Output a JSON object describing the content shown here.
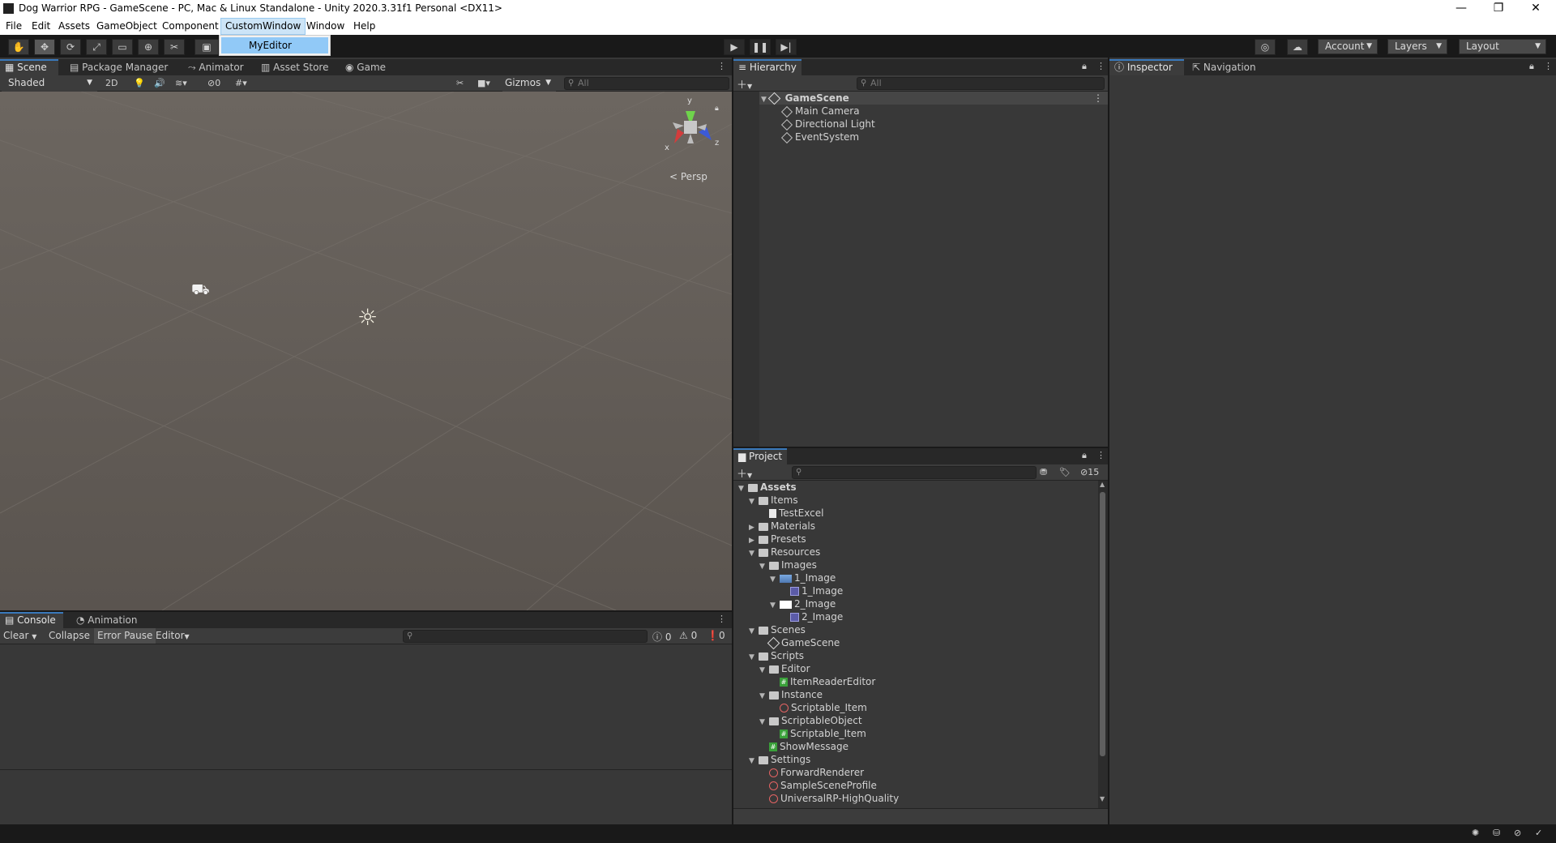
{
  "window": {
    "title": "Dog Warrior RPG - GameScene - PC, Mac & Linux Standalone - Unity 2020.3.31f1 Personal <DX11>",
    "minimize": "—",
    "maximize": "❐",
    "close": "✕"
  },
  "menu": {
    "items": [
      "File",
      "Edit",
      "Assets",
      "GameObject",
      "Component",
      "CustomWindow",
      "Window",
      "Help"
    ],
    "dropdown_item": "MyEditor"
  },
  "toolbar": {
    "account": "Account",
    "layers": "Layers",
    "layout": "Layout"
  },
  "scene_panel": {
    "tabs": [
      "Scene",
      "Package Manager",
      "Animator",
      "Asset Store",
      "Game"
    ],
    "shading": "Shaded",
    "mode_2d": "2D",
    "hidden_count": "0",
    "gizmos": "Gizmos",
    "search_placeholder": "All",
    "persp_label": "Persp",
    "axes": {
      "x": "x",
      "y": "y",
      "z": "z"
    }
  },
  "console": {
    "tabs": [
      "Console",
      "Animation"
    ],
    "clear": "Clear",
    "collapse": "Collapse",
    "error_pause": "Error Pause",
    "editor": "Editor",
    "log_count": "0",
    "warn_count": "0",
    "error_count": "0"
  },
  "hierarchy": {
    "tab": "Hierarchy",
    "search_placeholder": "All",
    "scene": "GameScene",
    "objects": [
      "Main Camera",
      "Directional Light",
      "EventSystem"
    ]
  },
  "project": {
    "tab": "Project",
    "hidden_count": "15",
    "tree": [
      {
        "label": "Assets",
        "depth": 0,
        "fold": "▼",
        "icon": "folder",
        "bold": true
      },
      {
        "label": "Items",
        "depth": 1,
        "fold": "▼",
        "icon": "folder"
      },
      {
        "label": "TestExcel",
        "depth": 2,
        "fold": "",
        "icon": "doc"
      },
      {
        "label": "Materials",
        "depth": 1,
        "fold": "▶",
        "icon": "folder"
      },
      {
        "label": "Presets",
        "depth": 1,
        "fold": "▶",
        "icon": "folder"
      },
      {
        "label": "Resources",
        "depth": 1,
        "fold": "▼",
        "icon": "folder"
      },
      {
        "label": "Images",
        "depth": 2,
        "fold": "▼",
        "icon": "folder"
      },
      {
        "label": "1_Image",
        "depth": 3,
        "fold": "▼",
        "icon": "img1"
      },
      {
        "label": "1_Image",
        "depth": 4,
        "fold": "",
        "icon": "sprite"
      },
      {
        "label": "2_Image",
        "depth": 3,
        "fold": "▼",
        "icon": "img2"
      },
      {
        "label": "2_Image",
        "depth": 4,
        "fold": "",
        "icon": "sprite"
      },
      {
        "label": "Scenes",
        "depth": 1,
        "fold": "▼",
        "icon": "folder"
      },
      {
        "label": "GameScene",
        "depth": 2,
        "fold": "",
        "icon": "unity"
      },
      {
        "label": "Scripts",
        "depth": 1,
        "fold": "▼",
        "icon": "folder"
      },
      {
        "label": "Editor",
        "depth": 2,
        "fold": "▼",
        "icon": "folder"
      },
      {
        "label": "ItemReaderEditor",
        "depth": 3,
        "fold": "",
        "icon": "script"
      },
      {
        "label": "Instance",
        "depth": 2,
        "fold": "▼",
        "icon": "folder"
      },
      {
        "label": "Scriptable_Item",
        "depth": 3,
        "fold": "",
        "icon": "so"
      },
      {
        "label": "ScriptableObject",
        "depth": 2,
        "fold": "▼",
        "icon": "folder"
      },
      {
        "label": "Scriptable_Item",
        "depth": 3,
        "fold": "",
        "icon": "script"
      },
      {
        "label": "ShowMessage",
        "depth": 2,
        "fold": "",
        "icon": "script"
      },
      {
        "label": "Settings",
        "depth": 1,
        "fold": "▼",
        "icon": "folder"
      },
      {
        "label": "ForwardRenderer",
        "depth": 2,
        "fold": "",
        "icon": "so"
      },
      {
        "label": "SampleSceneProfile",
        "depth": 2,
        "fold": "",
        "icon": "so"
      },
      {
        "label": "UniversalRP-HighQuality",
        "depth": 2,
        "fold": "",
        "icon": "so"
      }
    ]
  },
  "inspector": {
    "tabs": [
      "Inspector",
      "Navigation"
    ]
  }
}
